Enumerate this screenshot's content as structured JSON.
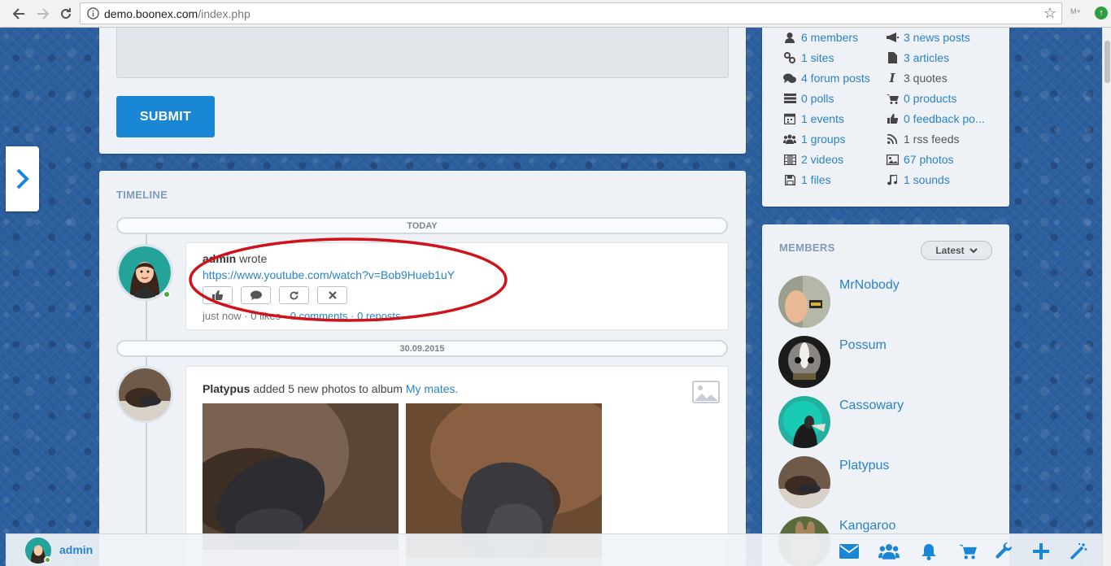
{
  "browser": {
    "url_host": "demo.boonex.com",
    "url_path": "/index.php",
    "ext_label": "M+"
  },
  "composer": {
    "submit_label": "SUBMIT"
  },
  "timeline": {
    "title": "TIMELINE",
    "groups": [
      {
        "label": "TODAY"
      },
      {
        "label": "30.09.2015"
      }
    ],
    "post1": {
      "author": "admin",
      "verb": "wrote",
      "link": "https://www.youtube.com/watch?v=Bob9Hueb1uY",
      "meta_time": "just now",
      "meta_likes": "0 likes",
      "meta_comments": "0 comments",
      "meta_reposts": "0 reposts",
      "actions": [
        "like-icon",
        "comment-icon",
        "repost-icon",
        "remove-icon"
      ]
    },
    "post2": {
      "author": "Platypus",
      "verb": "added 5 new photos to album",
      "album": "My mates."
    }
  },
  "stats": [
    {
      "icon": "user-icon",
      "label": "6 members"
    },
    {
      "icon": "megaphone-icon",
      "label": "3 news posts"
    },
    {
      "icon": "link-icon",
      "label": "1 sites"
    },
    {
      "icon": "file-icon",
      "label": "3 articles"
    },
    {
      "icon": "comments-icon",
      "label": "4 forum posts"
    },
    {
      "icon": "italic-icon",
      "label": "3 quotes"
    },
    {
      "icon": "tasks-icon",
      "label": "0 polls"
    },
    {
      "icon": "cart-icon",
      "label": "0 products"
    },
    {
      "icon": "calendar-icon",
      "label": "1 events"
    },
    {
      "icon": "thumbs-up-icon",
      "label": "0 feedback po..."
    },
    {
      "icon": "group-icon",
      "label": "1 groups"
    },
    {
      "icon": "rss-icon",
      "label": "1 rss feeds"
    },
    {
      "icon": "film-icon",
      "label": "2 videos"
    },
    {
      "icon": "picture-icon",
      "label": "67 photos"
    },
    {
      "icon": "save-icon",
      "label": "1 files"
    },
    {
      "icon": "music-icon",
      "label": "1 sounds"
    }
  ],
  "members": {
    "title": "MEMBERS",
    "filter_label": "Latest",
    "list": [
      {
        "name": "MrNobody"
      },
      {
        "name": "Possum"
      },
      {
        "name": "Cassowary"
      },
      {
        "name": "Platypus"
      },
      {
        "name": "Kangaroo"
      }
    ]
  },
  "bottom_bar": {
    "user_name": "admin",
    "icons": [
      "envelope-icon",
      "users-icon",
      "bell-icon",
      "cart-icon",
      "wrench-icon",
      "plus-icon",
      "magic-wand-icon"
    ]
  },
  "colors": {
    "accent": "#2a83c8",
    "button": "#1a86d6",
    "annotation": "#d0121b",
    "online": "#46b035"
  }
}
